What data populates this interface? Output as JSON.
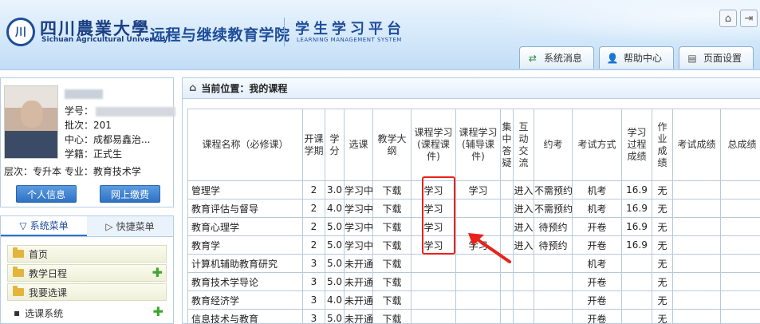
{
  "header": {
    "university_cn": "四川農業大學",
    "university_en": "Sichuan Agricultural University",
    "college": "远程与继续教育学院",
    "platform": "学生学习平台",
    "platform_en": "LEARNING MANAGEMENT SYSTEM",
    "tabs": [
      {
        "label": "系统消息",
        "icon": "message-icon"
      },
      {
        "label": "帮助中心",
        "icon": "help-person-icon"
      },
      {
        "label": "页面设置",
        "icon": "page-settings-icon"
      }
    ]
  },
  "profile": {
    "student_id_label": "学号：",
    "batch": "批次：201",
    "center": "中心：成都易鑫治...",
    "status": "学籍：正式生",
    "level_major": "层次：专升本  专业：教育技术学",
    "btn_info": "个人信息",
    "btn_pay": "网上缴费"
  },
  "menu": {
    "tab_system": "系统菜单",
    "tab_quick": "快捷菜单",
    "items": [
      "首页",
      "教学日程",
      "我要选课"
    ],
    "section": "选课系统"
  },
  "main": {
    "location": "当前位置：我的课程",
    "columns": [
      "课程名称（必修课）",
      "开课学期",
      "学分",
      "选课",
      "教学大纲",
      "课程学习(课程课件)",
      "课程学习(辅导课件)",
      "集中答疑",
      "互动交流",
      "约考",
      "考试方式",
      "学习过程成绩",
      "作业成绩",
      "考试成绩",
      "总成绩"
    ],
    "rows": [
      [
        "管理学",
        "2",
        "3.0",
        "学习中",
        "下载",
        "学习",
        "学习",
        "",
        "进入",
        "不需预约",
        "机考",
        "16.9",
        "无",
        "",
        ""
      ],
      [
        "教育评估与督导",
        "2",
        "4.0",
        "学习中",
        "下载",
        "学习",
        "",
        "",
        "进入",
        "不需预约",
        "机考",
        "16.9",
        "无",
        "",
        ""
      ],
      [
        "教育心理学",
        "2",
        "5.0",
        "学习中",
        "下载",
        "学习",
        "",
        "",
        "进入",
        "待预约",
        "开卷",
        "16.9",
        "无",
        "",
        ""
      ],
      [
        "教育学",
        "2",
        "5.0",
        "学习中",
        "下载",
        "学习",
        "学习",
        "",
        "进入",
        "待预约",
        "开卷",
        "16.9",
        "无",
        "",
        ""
      ],
      [
        "计算机辅助教育研究",
        "3",
        "5.0",
        "未开通",
        "下载",
        "",
        "",
        "",
        "",
        "",
        "机考",
        "",
        "无",
        "",
        ""
      ],
      [
        "教育技术学导论",
        "3",
        "5.0",
        "未开通",
        "下载",
        "",
        "",
        "",
        "",
        "",
        "开卷",
        "",
        "无",
        "",
        ""
      ],
      [
        "教育经济学",
        "3",
        "4.0",
        "未开通",
        "下载",
        "",
        "",
        "",
        "",
        "",
        "开卷",
        "",
        "无",
        "",
        ""
      ],
      [
        "信息技术与教育",
        "3",
        "5.0",
        "未开通",
        "下载",
        "",
        "",
        "",
        "",
        "",
        "开卷",
        "",
        "无",
        "",
        ""
      ]
    ]
  },
  "colors": {
    "accent": "#1e4d9a",
    "link": "#1a5aa8",
    "highlight": "#e8221c"
  }
}
